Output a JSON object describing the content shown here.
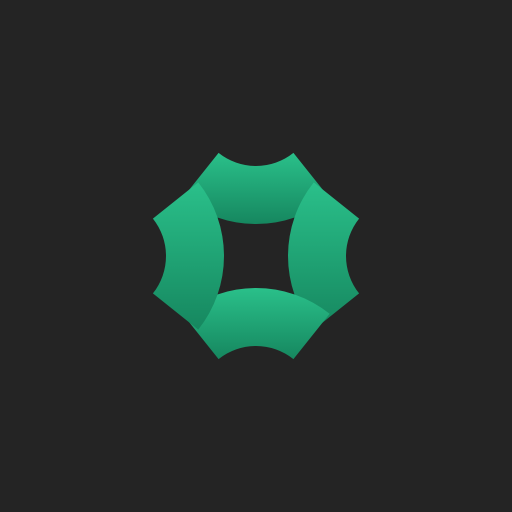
{
  "app_icon": {
    "name": "logo-icon",
    "background_color": "#242424",
    "mark_color": "#21B07D",
    "mark_color_highlight": "#2AC08A",
    "mark_color_shadow": "#16875F",
    "segments": [
      "top-arc",
      "right-arc",
      "bottom-arc",
      "left-arc"
    ]
  }
}
